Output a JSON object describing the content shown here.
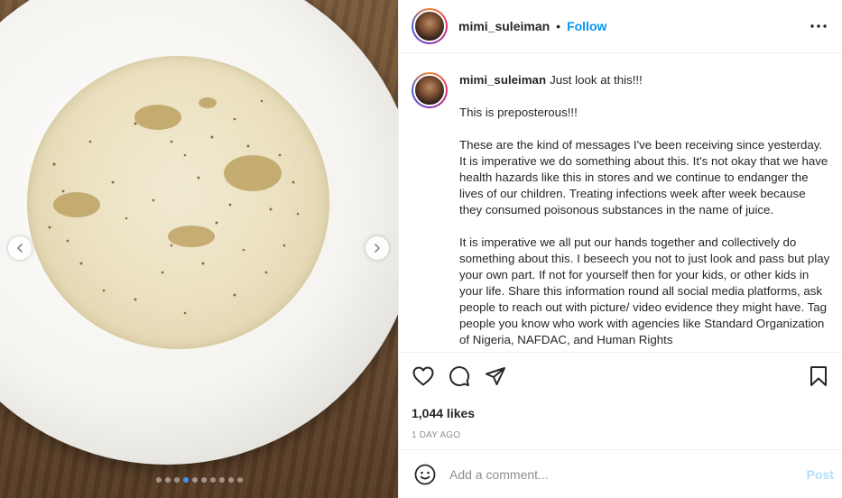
{
  "post": {
    "username": "mimi_suleiman",
    "separator": "•",
    "follow_label": "Follow",
    "more_icon": "more-horizontal-icon"
  },
  "media": {
    "description_icon": "photo",
    "carousel_count": 10,
    "carousel_active_index": 3,
    "prev_icon": "chevron-left-icon",
    "next_icon": "chevron-right-icon"
  },
  "caption": {
    "author": "mimi_suleiman",
    "first_line": "Just look at this!!!",
    "paragraphs": [
      "This is preposterous!!!",
      "These are the kind of messages I've been receiving since yesterday. It is imperative we do something about this. It's not okay that we have health hazards like this in stores and we continue to endanger the lives of our children. Treating infections week after week because they consumed poisonous substances in the name of juice.",
      "It is imperative we all put our hands together and collectively do something about this. I beseech you not to just look and pass but play your own part. If not for yourself then for your kids, or other kids in your life. Share this information round all social media platforms, ask people to reach out with picture/ video evidence they might have. Tag people you know who work with agencies like Standard Organization of Nigeria, NAFDAC, and Human Rights"
    ]
  },
  "actions": {
    "like_icon": "heart-icon",
    "comment_icon": "comment-icon",
    "share_icon": "share-icon",
    "save_icon": "bookmark-icon"
  },
  "stats": {
    "likes": "1,044 likes",
    "timestamp": "1 DAY AGO"
  },
  "comment_box": {
    "emoji_icon": "emoji-icon",
    "placeholder": "Add a comment...",
    "value": "",
    "post_label": "Post",
    "post_color": "#b2dffc"
  },
  "colors": {
    "accent": "#0095f6",
    "text": "#262626",
    "muted": "#8e8e8e",
    "active_dot": "#3897f0"
  }
}
